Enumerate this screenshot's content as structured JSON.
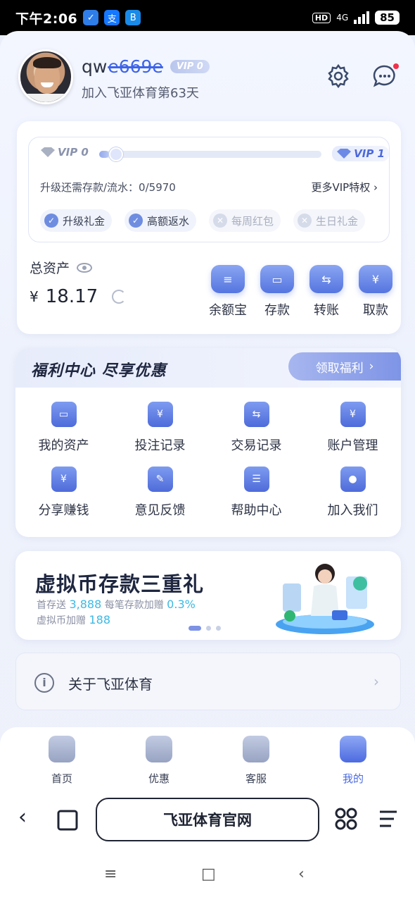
{
  "status_bar": {
    "time": "下午2:06",
    "network": "4G",
    "hd_label": "HD",
    "battery": "85"
  },
  "profile": {
    "username_visible": "qw",
    "username_obscured": "e669e",
    "vip_badge": "VIP 0",
    "join_days": "加入飞亚体育第63天"
  },
  "vip": {
    "current_label": "VIP 0",
    "next_label": "VIP 1",
    "progress_fraction": 0.0,
    "upgrade_text": "升级还需存款/流水：0/5970",
    "more_link": "更多VIP特权",
    "perks": [
      {
        "label": "升级礼金",
        "enabled": true
      },
      {
        "label": "高额返水",
        "enabled": true
      },
      {
        "label": "每周红包",
        "enabled": false
      },
      {
        "label": "生日礼金",
        "enabled": false
      }
    ]
  },
  "assets": {
    "total_label": "总资产",
    "currency": "¥",
    "balance": "18.17",
    "actions": [
      {
        "label": "余额宝",
        "icon": "coin-stack-icon"
      },
      {
        "label": "存款",
        "icon": "wallet-icon"
      },
      {
        "label": "转账",
        "icon": "transfer-icon"
      },
      {
        "label": "取款",
        "icon": "withdraw-icon"
      }
    ]
  },
  "welfare": {
    "title": "福利中心  尽享优惠",
    "claim_button": "领取福利",
    "items": [
      {
        "label": "我的资产",
        "icon": "wallet-icon"
      },
      {
        "label": "投注记录",
        "icon": "bet-record-icon"
      },
      {
        "label": "交易记录",
        "icon": "transaction-icon"
      },
      {
        "label": "账户管理",
        "icon": "account-folder-icon"
      },
      {
        "label": "分享赚钱",
        "icon": "share-money-icon"
      },
      {
        "label": "意见反馈",
        "icon": "feedback-icon"
      },
      {
        "label": "帮助中心",
        "icon": "help-book-icon"
      },
      {
        "label": "加入我们",
        "icon": "users-icon"
      }
    ]
  },
  "promo": {
    "title": "虚拟币存款三重礼",
    "line1_prefix": "首存送",
    "line1_value": "3,888",
    "line1_mid": "每笔存款加赠",
    "line1_value2": "0.3%",
    "line2_prefix": "虚拟币加赠",
    "line2_value": "188"
  },
  "about": {
    "label": "关于飞亚体育"
  },
  "tabs": [
    {
      "label": "首页",
      "icon": "home-icon",
      "active": false
    },
    {
      "label": "优惠",
      "icon": "gift-icon",
      "active": false
    },
    {
      "label": "客服",
      "icon": "headset-icon",
      "active": false
    },
    {
      "label": "我的",
      "icon": "person-icon",
      "active": true
    }
  ],
  "browser": {
    "url_title": "飞亚体育官网"
  },
  "colors": {
    "accent": "#4d6be0",
    "highlight": "#3db9e3"
  }
}
